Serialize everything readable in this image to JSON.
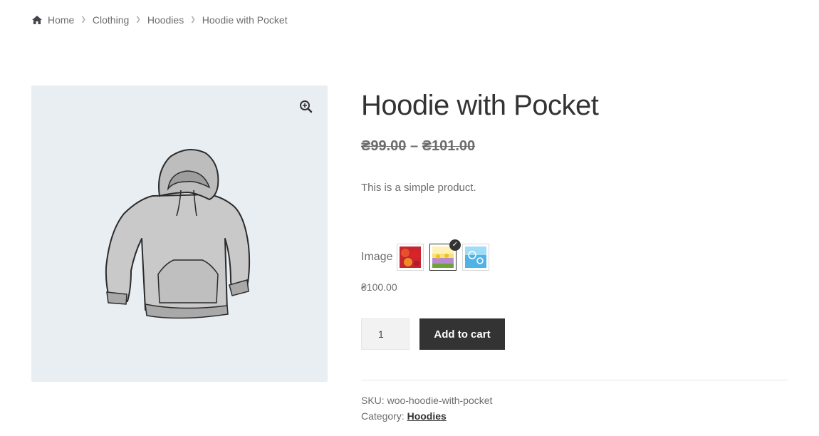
{
  "breadcrumb": {
    "items": [
      "Home",
      "Clothing",
      "Hoodies"
    ],
    "current": "Hoodie with Pocket"
  },
  "product": {
    "title": "Hoodie with Pocket",
    "price_range_low": "₴99.00",
    "price_range_sep": "–",
    "price_range_high": "₴101.00",
    "description": "This is a simple product."
  },
  "variation": {
    "label": "Image",
    "swatches": [
      "red-autumn-leaves",
      "yellow-flowers",
      "blue-snowflakes"
    ],
    "selected_index": 1,
    "price": "₴100.00"
  },
  "cart": {
    "quantity": "1",
    "add_label": "Add to cart"
  },
  "meta": {
    "sku_label": "SKU:",
    "sku": "woo-hoodie-with-pocket",
    "category_label": "Category:",
    "category": "Hoodies"
  },
  "colors": {
    "gallery_bg": "#e9eef3",
    "button_bg": "#333333",
    "text": "#6d6d6d"
  }
}
